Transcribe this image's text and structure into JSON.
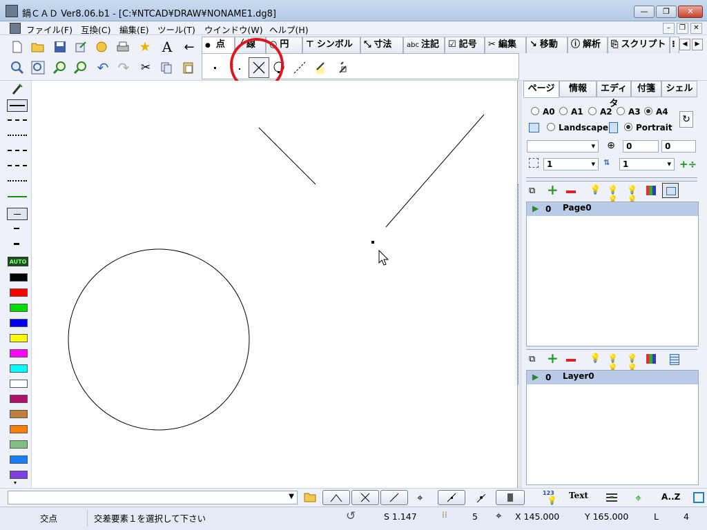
{
  "window": {
    "title": "鍋ＣＡＤ Ver8.06.b1 - [C:¥NTCAD¥DRAW¥NONAME1.dg8]",
    "minimize": "—",
    "restore": "❐",
    "close": "✕"
  },
  "menu": [
    "ファイル(F)",
    "互換(C)",
    "編集(E)",
    "ツール(T)",
    "ウインドウ(W)",
    "ヘルプ(H)"
  ],
  "main_tabs": [
    {
      "label": "点",
      "active": true
    },
    {
      "label": "線"
    },
    {
      "label": "円"
    },
    {
      "label": "シンボル"
    },
    {
      "label": "寸法"
    },
    {
      "label": "注記",
      "prefix": "abc"
    },
    {
      "label": "記号"
    },
    {
      "label": "編集"
    },
    {
      "label": "移動"
    },
    {
      "label": "解析"
    },
    {
      "label": "スクリプト"
    }
  ],
  "text_tool": "A",
  "right_panel": {
    "tabs": [
      "ページ",
      "情報",
      "エディタ",
      "付箋",
      "シェル"
    ],
    "paper_sizes": [
      "A0",
      "A1",
      "A2",
      "A3",
      "A4"
    ],
    "paper_selected": "A4",
    "orientation": [
      "Landscape",
      "Portrait"
    ],
    "orientation_selected": "Portrait",
    "offset_x": "0",
    "offset_y": "0",
    "scale_value": "1",
    "count_value": "1",
    "page_row": {
      "index": "0",
      "name": "Page0"
    },
    "layer_row": {
      "index": "0",
      "name": "Layer0"
    }
  },
  "left_palette": {
    "auto_label": "AUTO",
    "colors": [
      "#000000",
      "#ff0000",
      "#00dd00",
      "#0000ee",
      "#ffff00",
      "#ff00ff",
      "#00ffff",
      "#ffffff",
      "#b0106a",
      "#c08040",
      "#ff8000",
      "#80c080",
      "#1a7fff",
      "#8040e0"
    ]
  },
  "bottom_bar": {
    "text_button": "Text",
    "sort_button": "A..Z",
    "num_badge": "123"
  },
  "status": {
    "mode": "交点",
    "prompt": "交差要素１を選択して下さい",
    "scale": "S 1.147",
    "grid": "5",
    "x": "X 145.000",
    "y": "Y 165.000",
    "layer_label": "L",
    "layer_value": "4"
  },
  "accent": {
    "highlight_ring": "#e0141c",
    "selected_row": "#b9cbe6"
  }
}
